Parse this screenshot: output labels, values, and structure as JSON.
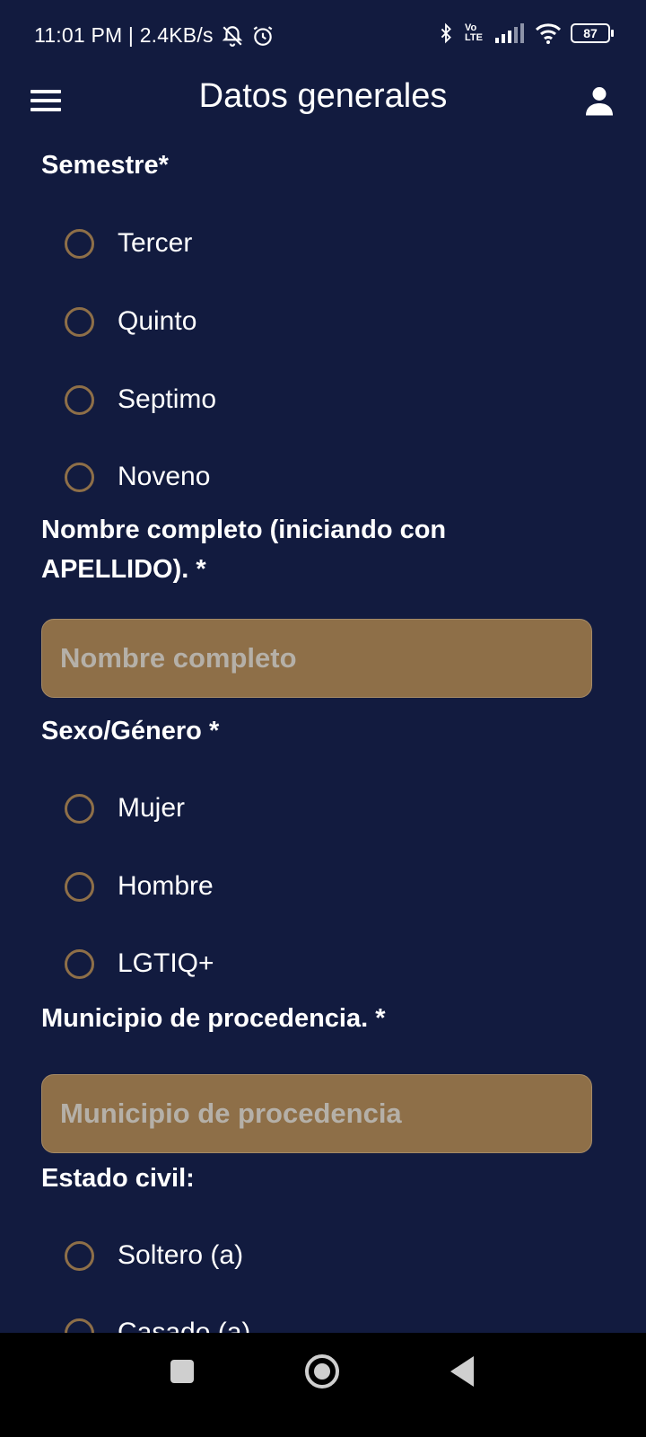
{
  "status_bar": {
    "time_info": "11:01 PM | 2.4KB/s",
    "battery": "87",
    "network_label": "Vo LTE"
  },
  "app_bar": {
    "title": "Datos generales",
    "menu_icon": "hamburger-menu-icon",
    "profile_icon": "user-icon"
  },
  "form": {
    "semestre": {
      "label": "Semestre*",
      "options": [
        "Tercer",
        "Quinto",
        "Septimo",
        "Noveno"
      ]
    },
    "nombre": {
      "label": "Nombre completo (iniciando con APELLIDO). *",
      "placeholder": "Nombre completo",
      "value": ""
    },
    "sexo": {
      "label": "Sexo/Género *",
      "options": [
        "Mujer",
        "Hombre",
        "LGTIQ+"
      ]
    },
    "municipio": {
      "label": "Municipio de procedencia. *",
      "placeholder": "Municipio de procedencia",
      "value": ""
    },
    "estado_civil": {
      "label": "Estado civil:",
      "options": [
        "Soltero (a)",
        "Casado (a)"
      ]
    }
  },
  "colors": {
    "background": "#121b3f",
    "accent": "#8e6f48",
    "text": "#ffffff"
  }
}
